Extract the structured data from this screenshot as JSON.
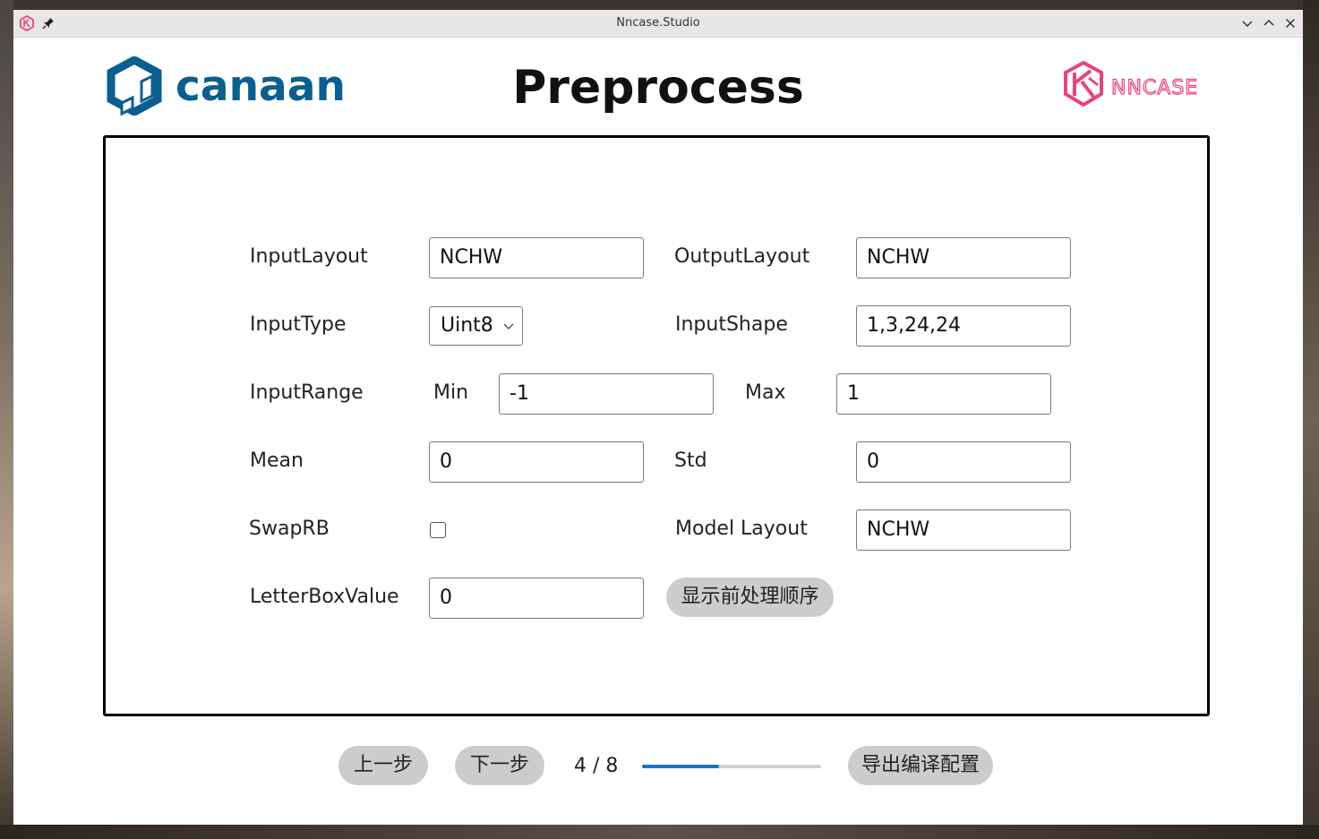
{
  "window": {
    "title": "Nncase.Studio"
  },
  "header": {
    "canaan_logo_text": "canaan",
    "page_title": "Preprocess",
    "nncase_logo_text": "NNCASE"
  },
  "form": {
    "input_layout": {
      "label": "InputLayout",
      "value": "NCHW"
    },
    "output_layout": {
      "label": "OutputLayout",
      "value": "NCHW"
    },
    "input_type": {
      "label": "InputType",
      "value": "Uint8"
    },
    "input_shape": {
      "label": "InputShape",
      "value": "1,3,24,24"
    },
    "input_range": {
      "label": "InputRange",
      "min_label": "Min",
      "min_value": "-1",
      "max_label": "Max",
      "max_value": "1"
    },
    "mean": {
      "label": "Mean",
      "value": "0"
    },
    "std": {
      "label": "Std",
      "value": "0"
    },
    "swap_rb": {
      "label": "SwapRB",
      "checked": false
    },
    "model_layout": {
      "label": "Model Layout",
      "value": "NCHW"
    },
    "letterbox": {
      "label": "LetterBoxValue",
      "value": "0"
    },
    "show_order_button": "显示前处理顺序"
  },
  "footer": {
    "prev_button": "上一步",
    "next_button": "下一步",
    "page_indicator": "4 / 8",
    "progress_fraction": 0.43,
    "export_button": "导出编译配置"
  },
  "colors": {
    "canaan_blue": "#0a5f8e",
    "nncase_pink": "#e8457a",
    "progress_blue": "#1a73c8"
  }
}
